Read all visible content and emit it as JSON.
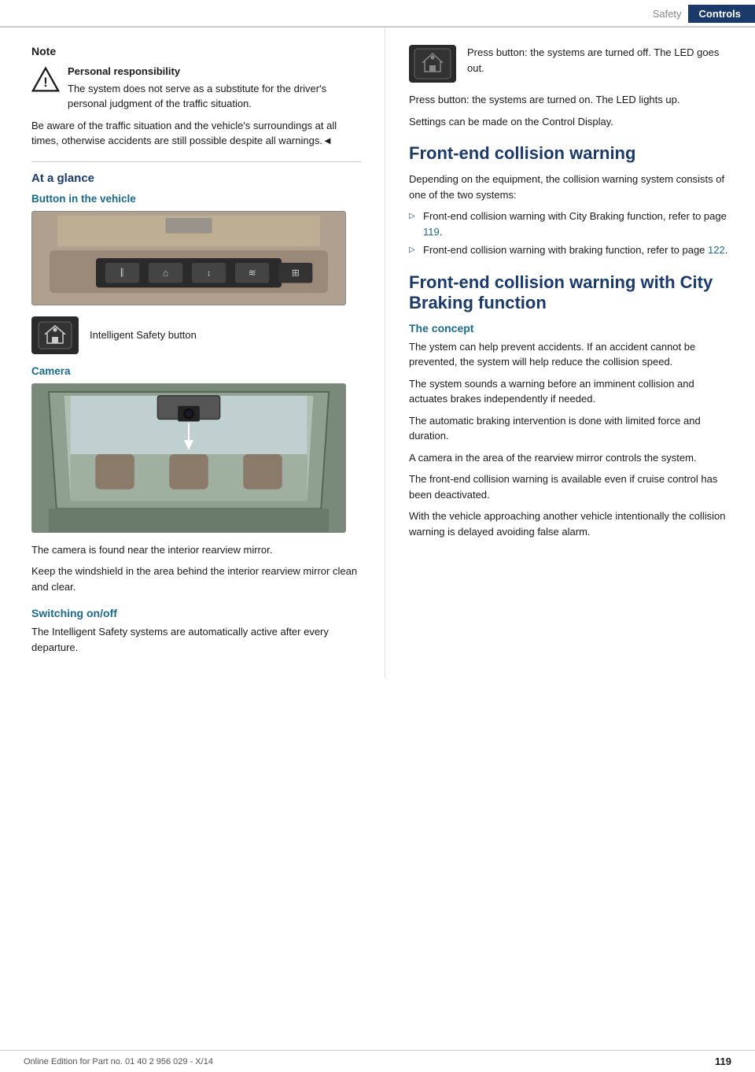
{
  "header": {
    "safety_label": "Safety",
    "controls_label": "Controls"
  },
  "left": {
    "note_title": "Note",
    "personal_resp": "Personal responsibility",
    "note_body1": "The system does not serve as a substitute for the driver's personal judgment of the traffic situation.",
    "note_body2": "Be aware of the traffic situation and the vehicle's surroundings at all times, otherwise accidents are still possible despite all warnings.◄",
    "at_glance": "At a glance",
    "button_in_vehicle": "Button in the vehicle",
    "isb_label": "Intelligent Safety button",
    "camera_heading": "Camera",
    "camera_text1": "The camera is found near the interior rearview mirror.",
    "camera_text2": "Keep the windshield in the area behind the interior rearview mirror clean and clear.",
    "switching_heading": "Switching on/off",
    "switching_text": "The Intelligent Safety systems are automatically active after every departure."
  },
  "right": {
    "press_off_text": "Press button: the systems are turned off. The LED goes out.",
    "press_on_text": "Press button: the systems are turned on. The LED lights up.",
    "settings_text": "Settings can be made on the Control Display.",
    "collision_heading": "Front-end collision warning",
    "collision_intro": "Depending on the equipment, the collision warning system consists of one of the two systems:",
    "bullet1": "Front-end collision warning with City Braking function, refer to page 119.",
    "bullet1_page": "119",
    "bullet2": "Front-end collision warning with braking function, refer to page 122.",
    "bullet2_page": "122",
    "collision_city_heading": "Front-end collision warning with City Braking function",
    "concept_heading": "The concept",
    "concept1": "The ystem can help prevent accidents. If an accident cannot be prevented, the system will help reduce the collision speed.",
    "concept2": "The system sounds a warning before an imminent collision and actuates brakes independently if needed.",
    "concept3": "The automatic braking intervention is done with limited force and duration.",
    "concept4": "A camera in the area of the rearview mirror controls the system.",
    "concept5": "The front-end collision warning is available even if cruise control has been deactivated.",
    "concept6": "With the vehicle approaching another vehicle intentionally the collision warning is delayed avoiding false alarm."
  },
  "footer": {
    "text": "Online Edition for Part no. 01 40 2 956 029 - X/14",
    "page": "119"
  }
}
